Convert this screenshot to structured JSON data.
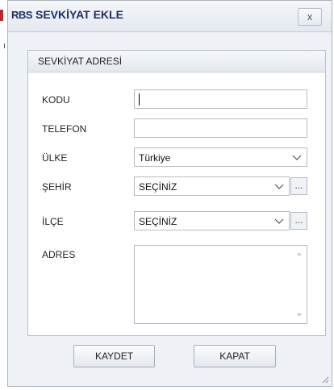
{
  "window": {
    "logo": "RBS",
    "title": "SEVKİYAT EKLE",
    "close_label": "x"
  },
  "group": {
    "title": "SEVKİYAT ADRESİ"
  },
  "fields": {
    "kodu": {
      "label": "KODU",
      "value": ""
    },
    "telefon": {
      "label": "TELEFON",
      "value": ""
    },
    "ulke": {
      "label": "ÜLKE",
      "value": "Türkiye"
    },
    "sehir": {
      "label": "ŞEHİR",
      "value": "SEÇİNİZ",
      "browse_label": "..."
    },
    "ilce": {
      "label": "İLÇE",
      "value": "SEÇİNİZ",
      "browse_label": "..."
    },
    "adres": {
      "label": "ADRES",
      "value": ""
    }
  },
  "buttons": {
    "save_label": "KAYDET",
    "close_label": "KAPAT"
  },
  "icons": {
    "combo_arrow": "chevron-down-icon",
    "scroll_up": "scroll-up-arrow-icon",
    "scroll_down": "scroll-down-arrow-icon",
    "resize": "resize-grip-icon"
  },
  "colors": {
    "title_text": "#1a2f66",
    "border": "#b3bcc8",
    "window_bg": "#eef1f5"
  }
}
